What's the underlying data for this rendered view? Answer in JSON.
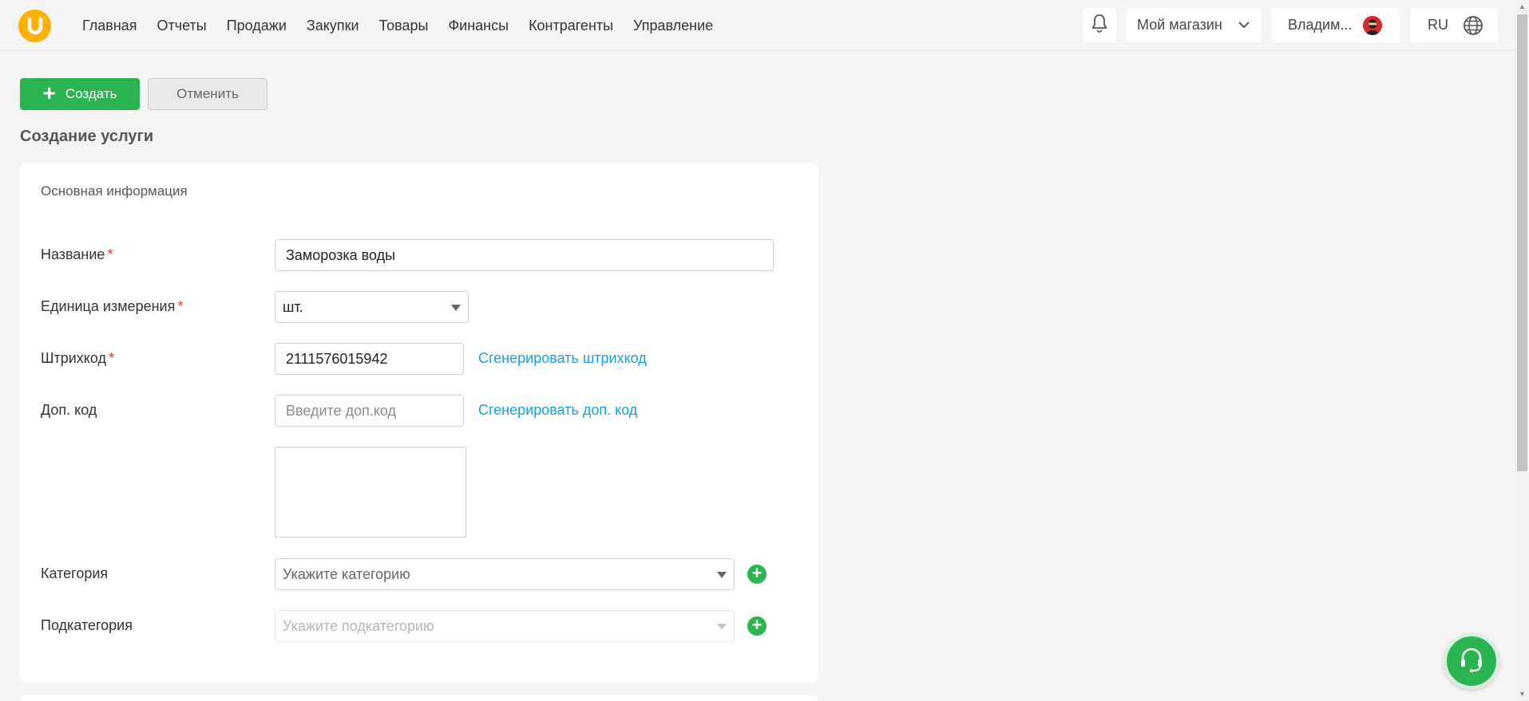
{
  "nav": {
    "items": [
      "Главная",
      "Отчеты",
      "Продажи",
      "Закупки",
      "Товары",
      "Финансы",
      "Контрагенты",
      "Управление"
    ]
  },
  "header": {
    "logo_letter": "U",
    "store": "Мой магазин",
    "user": "Владим...",
    "lang": "RU"
  },
  "actions": {
    "create_label": "Создать",
    "create_plus": "+",
    "cancel_label": "Отменить"
  },
  "page": {
    "title": "Создание услуги",
    "section_title": "Основная информация"
  },
  "form": {
    "name_label": "Название",
    "name_value": "Заморозка воды",
    "unit_label": "Единица измерения",
    "unit_value": "шт.",
    "barcode_label": "Штрихкод",
    "barcode_value": "2111576015942",
    "barcode_generate": "Сгенерировать штрихкод",
    "extra_code_label": "Доп. код",
    "extra_code_placeholder": "Введите доп.код",
    "extra_code_generate": "Сгенерировать доп. код",
    "category_label": "Категория",
    "category_placeholder": "Укажите категорию",
    "subcategory_label": "Подкатегория",
    "subcategory_placeholder": "Укажите подкатегорию",
    "required_mark": "*",
    "add_symbol": "+"
  },
  "colors": {
    "accent_green": "#2ab551",
    "link_blue": "#1a9fe0",
    "logo_orange": "#ffb000",
    "required_red": "#e53935"
  },
  "icons": [
    "logo-icon",
    "bell-icon",
    "chevron-down-icon",
    "avatar",
    "globe-icon",
    "plus-icon",
    "dropdown-arrow-icon",
    "add-circle-icon",
    "headset-icon"
  ]
}
